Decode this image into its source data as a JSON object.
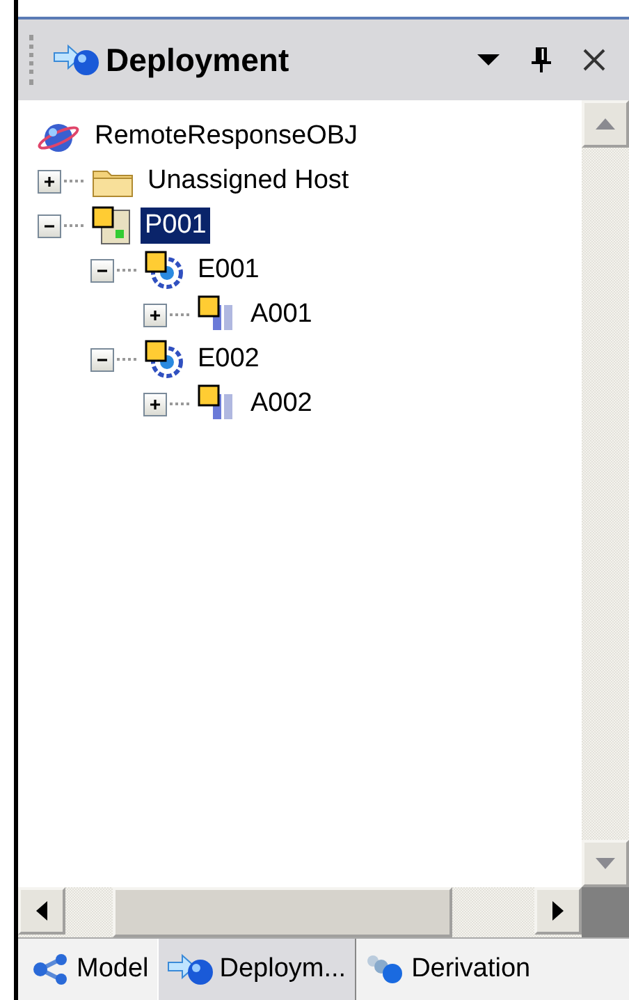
{
  "panel": {
    "title": "Deployment"
  },
  "tree": [
    {
      "kind": "root",
      "label": "RemoteResponseOBJ",
      "selected": false,
      "children": [
        {
          "kind": "folder",
          "label": "Unassigned Host",
          "selected": false,
          "expanded": false
        },
        {
          "kind": "partition",
          "label": "P001",
          "selected": true,
          "expanded": true,
          "children": [
            {
              "kind": "engine",
              "label": "E001",
              "selected": false,
              "expanded": true,
              "children": [
                {
                  "kind": "agent",
                  "label": "A001",
                  "selected": false,
                  "expanded": false
                }
              ]
            },
            {
              "kind": "engine",
              "label": "E002",
              "selected": false,
              "expanded": true,
              "children": [
                {
                  "kind": "agent",
                  "label": "A002",
                  "selected": false,
                  "expanded": false
                }
              ]
            }
          ]
        }
      ]
    }
  ],
  "tabs": [
    {
      "kind": "model",
      "label": "Model",
      "selected": false
    },
    {
      "kind": "deployment",
      "label": "Deploym...",
      "selected": true
    },
    {
      "kind": "derivation",
      "label": "Derivation",
      "selected": false
    }
  ]
}
